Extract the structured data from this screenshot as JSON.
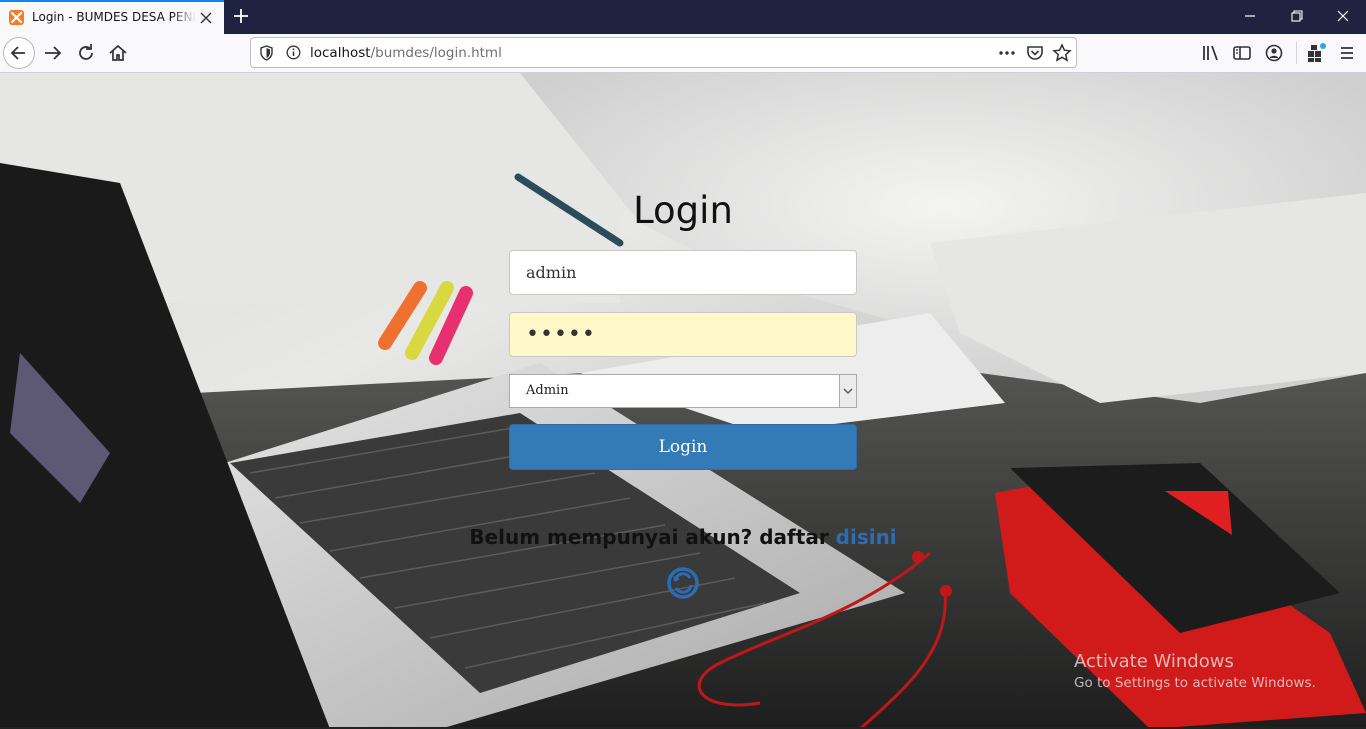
{
  "browser": {
    "tab_title": "Login - BUMDES DESA PENDEM",
    "url_host": "localhost",
    "url_path": "/bumdes/login.html",
    "accent_color": "#0a84ff",
    "titlebar_color": "#202340"
  },
  "login": {
    "title": "Login",
    "username_value": "admin",
    "password_value": "•••••",
    "role_selected": "Admin",
    "submit_label": "Login",
    "button_color": "#337ab7"
  },
  "register": {
    "prompt": "Belum mempunyai akun? daftar ",
    "link_label": "disini",
    "link_color": "#2a6db5"
  },
  "watermark": {
    "title": "Activate Windows",
    "subtitle": "Go to Settings to activate Windows."
  }
}
